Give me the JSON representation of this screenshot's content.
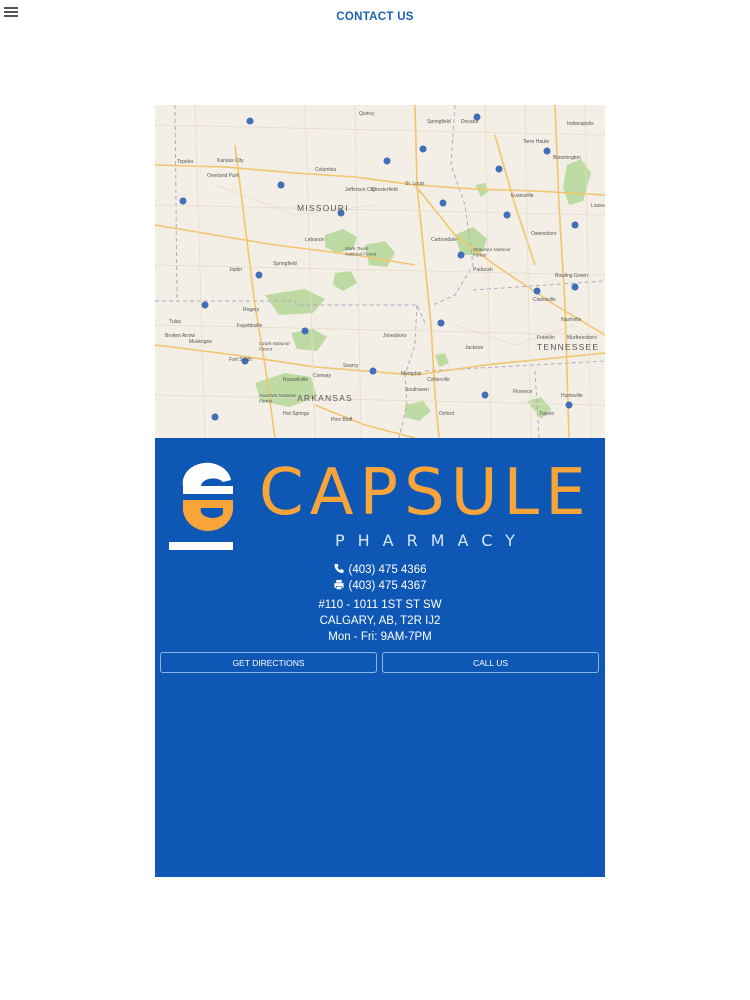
{
  "header": {
    "title": "CONTACT US",
    "menu_icon": "hamburger-menu-icon"
  },
  "map": {
    "region_labels": [
      "MISSOURI",
      "ARKANSAS",
      "TENNESSEE"
    ],
    "cities": [
      "Quincy",
      "Springfield",
      "Decatur",
      "Indianapolis",
      "Kansas City",
      "Topeka",
      "Overland Park",
      "Columbia",
      "Terre Haute",
      "Bloomington",
      "Jefferson City",
      "Chesterfield",
      "St. Louis",
      "Evansville",
      "Louisville",
      "Lebanon",
      "Carbondale",
      "Owensboro",
      "Springfield",
      "Joplin",
      "Paducah",
      "Bowling Green",
      "Clarksville",
      "Nashville",
      "Rogers",
      "Fayetteville",
      "Jonesboro",
      "Tulsa",
      "Broken Arrow",
      "Muskogee",
      "Fort Smith",
      "Searcy",
      "Memphis",
      "Collierville",
      "Jackson",
      "Franklin",
      "Murfreesboro",
      "Russellville",
      "Conway",
      "Southaven",
      "Florence",
      "Huntsville",
      "Hot Springs",
      "Pine Bluff",
      "Oxford",
      "Tupelo"
    ],
    "forest_labels": [
      "Mark Twain National Forest",
      "Shawnee National Forest",
      "Ozark National Forest",
      "Ouachita National Forest"
    ]
  },
  "brand": {
    "name": "CAPSULE",
    "sub": "PHARMACY",
    "primary_color": "#0f57b5",
    "accent_color": "#f7a43b"
  },
  "contact": {
    "phone": "(403) 475 4366",
    "fax": "(403) 475 4367",
    "address_line1": "#110 - 1011 1ST ST SW",
    "address_line2": "CALGARY, AB, T2R IJ2",
    "hours": "Mon - Fri: 9AM-7PM",
    "phone_icon": "phone-icon",
    "fax_icon": "fax-icon"
  },
  "actions": {
    "directions_label": "GET DIRECTIONS",
    "call_label": "CALL US"
  }
}
